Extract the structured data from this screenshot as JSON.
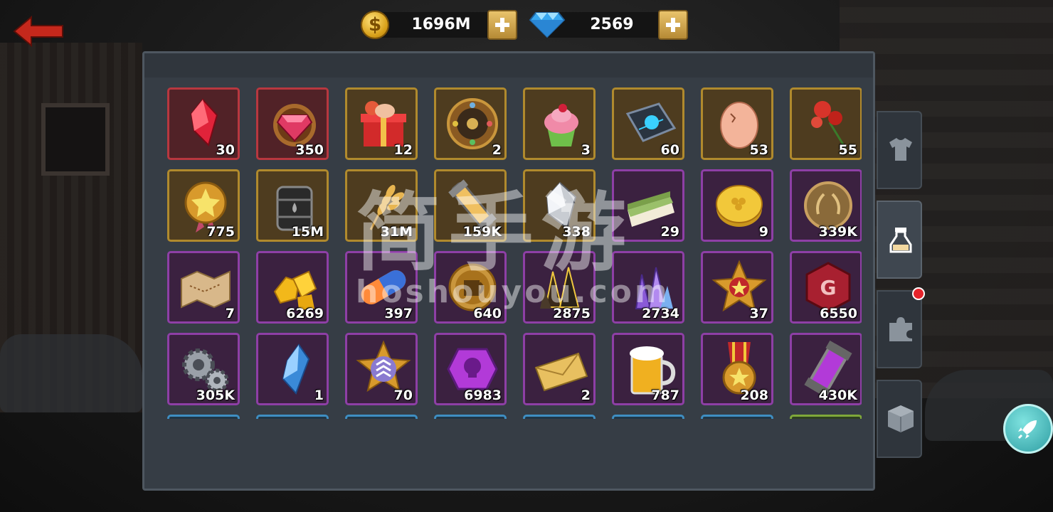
{
  "colors": {
    "accent_gold": "#b08a2d",
    "accent_purple": "#8e3fa6",
    "accent_red": "#b8373f",
    "accent_blue": "#3e8ec2"
  },
  "currency": {
    "gold": {
      "icon": "gold-coin-icon",
      "symbol": "$",
      "value": "1696M"
    },
    "diamond": {
      "icon": "diamond-icon",
      "value": "2569"
    }
  },
  "watermark": {
    "text": "简手游",
    "url": "hoshouyou.com"
  },
  "items": [
    {
      "name": "red-crystal",
      "icon": "red-crystal-icon",
      "rarity": "red",
      "count": "30"
    },
    {
      "name": "ruby-emblem",
      "icon": "ruby-emblem-icon",
      "rarity": "red",
      "count": "350"
    },
    {
      "name": "gift-box",
      "icon": "gift-box-icon",
      "rarity": "gold",
      "count": "12"
    },
    {
      "name": "compass-wheel",
      "icon": "compass-wheel-icon",
      "rarity": "gold",
      "count": "2"
    },
    {
      "name": "cupcake",
      "icon": "cupcake-icon",
      "rarity": "gold",
      "count": "3"
    },
    {
      "name": "tech-card",
      "icon": "tech-card-icon",
      "rarity": "gold",
      "count": "60"
    },
    {
      "name": "egg",
      "icon": "egg-icon",
      "rarity": "gold",
      "count": "53"
    },
    {
      "name": "roses",
      "icon": "rose-icon",
      "rarity": "gold",
      "count": "55"
    },
    {
      "name": "star-medal",
      "icon": "star-medal-icon",
      "rarity": "gold",
      "count": "775"
    },
    {
      "name": "oil-barrel",
      "icon": "oil-barrel-icon",
      "rarity": "gold",
      "count": "15M"
    },
    {
      "name": "wheat",
      "icon": "wheat-icon",
      "rarity": "gold",
      "count": "31M"
    },
    {
      "name": "energy-capsule",
      "icon": "energy-capsule-icon",
      "rarity": "gold",
      "count": "159K"
    },
    {
      "name": "silver-crystal",
      "icon": "silver-crystal-icon",
      "rarity": "gold",
      "count": "338"
    },
    {
      "name": "cake-slice",
      "icon": "cake-slice-icon",
      "rarity": "purple",
      "count": "29"
    },
    {
      "name": "gold-coin",
      "icon": "clover-coin-icon",
      "rarity": "purple",
      "count": "9"
    },
    {
      "name": "laurel-coin",
      "icon": "laurel-coin-icon",
      "rarity": "purple",
      "count": "339K"
    },
    {
      "name": "map",
      "icon": "map-icon",
      "rarity": "purple",
      "count": "7"
    },
    {
      "name": "gold-ore",
      "icon": "gold-ore-icon",
      "rarity": "purple",
      "count": "6269"
    },
    {
      "name": "pill",
      "icon": "pill-icon",
      "rarity": "purple",
      "count": "397"
    },
    {
      "name": "mug-coin",
      "icon": "mug-coin-icon",
      "rarity": "purple",
      "count": "640"
    },
    {
      "name": "dark-crystals",
      "icon": "dark-crystals-icon",
      "rarity": "purple",
      "count": "2875"
    },
    {
      "name": "purple-crystals",
      "icon": "purple-crystals-icon",
      "rarity": "purple",
      "count": "2734"
    },
    {
      "name": "star-badge",
      "icon": "star-badge-icon",
      "rarity": "purple",
      "count": "37"
    },
    {
      "name": "g-token",
      "icon": "g-token-icon",
      "rarity": "purple",
      "count": "6550"
    },
    {
      "name": "gears",
      "icon": "gears-icon",
      "rarity": "purple",
      "count": "305K"
    },
    {
      "name": "blue-crystal",
      "icon": "blue-crystal-icon",
      "rarity": "purple",
      "count": "1"
    },
    {
      "name": "rank-badge",
      "icon": "rank-badge-icon",
      "rarity": "purple",
      "count": "70"
    },
    {
      "name": "skull-gem",
      "icon": "skull-gem-icon",
      "rarity": "purple",
      "count": "6983"
    },
    {
      "name": "envelope",
      "icon": "envelope-icon",
      "rarity": "purple",
      "count": "2"
    },
    {
      "name": "beer-mug",
      "icon": "beer-mug-icon",
      "rarity": "purple",
      "count": "787"
    },
    {
      "name": "medal",
      "icon": "medal-icon",
      "rarity": "purple",
      "count": "208"
    },
    {
      "name": "purple-capsule",
      "icon": "purple-capsule-icon",
      "rarity": "purple",
      "count": "430K"
    },
    {
      "name": "hidden-1",
      "icon": "",
      "rarity": "blue",
      "count": ""
    },
    {
      "name": "hidden-2",
      "icon": "",
      "rarity": "blue",
      "count": ""
    },
    {
      "name": "hidden-3",
      "icon": "",
      "rarity": "blue",
      "count": ""
    },
    {
      "name": "hidden-4",
      "icon": "",
      "rarity": "blue",
      "count": ""
    },
    {
      "name": "hidden-5",
      "icon": "",
      "rarity": "blue",
      "count": ""
    },
    {
      "name": "hidden-6",
      "icon": "",
      "rarity": "blue",
      "count": ""
    },
    {
      "name": "hidden-7",
      "icon": "",
      "rarity": "blue",
      "count": ""
    },
    {
      "name": "hidden-8",
      "icon": "",
      "rarity": "green",
      "count": ""
    }
  ],
  "tabs": [
    {
      "name": "equipment",
      "icon": "shirt-icon",
      "active": false
    },
    {
      "name": "consumables",
      "icon": "potion-icon",
      "active": true
    },
    {
      "name": "fragments",
      "icon": "puzzle-icon",
      "active": false,
      "badge": true
    },
    {
      "name": "materials",
      "icon": "box-icon",
      "active": false
    }
  ]
}
